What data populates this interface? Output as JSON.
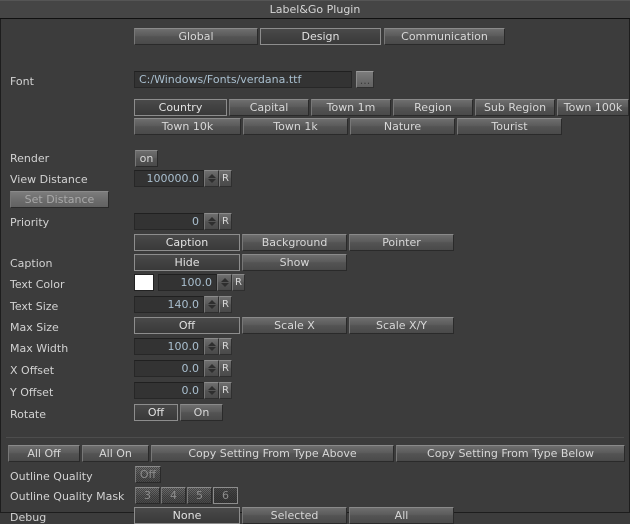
{
  "window": {
    "title": "Label&Go Plugin"
  },
  "main_tabs": [
    {
      "label": "Global",
      "active": false
    },
    {
      "label": "Design",
      "active": true
    },
    {
      "label": "Communication",
      "active": false
    }
  ],
  "font": {
    "label": "Font",
    "path": "C:/Windows/Fonts/verdana.ttf",
    "browse_label": "...",
    "browse_icon": "ellipsis-icon"
  },
  "type_tabs_row1": [
    {
      "label": "Country",
      "active": true
    },
    {
      "label": "Capital",
      "active": false
    },
    {
      "label": "Town 1m",
      "active": false
    },
    {
      "label": "Region",
      "active": false
    },
    {
      "label": "Sub Region",
      "active": false
    },
    {
      "label": "Town 100k",
      "active": false
    }
  ],
  "type_tabs_row2": [
    {
      "label": "Town 10k",
      "active": false
    },
    {
      "label": "Town 1k",
      "active": false
    },
    {
      "label": "Nature",
      "active": false
    },
    {
      "label": "Tourist",
      "active": false
    }
  ],
  "render": {
    "label": "Render",
    "value": "on"
  },
  "view_distance": {
    "label": "View Distance",
    "value": "100000.0",
    "reset_label": "R"
  },
  "set_distance": {
    "label": "Set Distance"
  },
  "priority": {
    "label": "Priority",
    "value": "0",
    "reset_label": "R"
  },
  "element_tabs": [
    {
      "label": "Caption",
      "active": true
    },
    {
      "label": "Background",
      "active": false
    },
    {
      "label": "Pointer",
      "active": false
    }
  ],
  "caption": {
    "label": "Caption",
    "options": [
      {
        "label": "Hide",
        "active": true
      },
      {
        "label": "Show",
        "active": false
      }
    ]
  },
  "text_color": {
    "label": "Text Color",
    "swatch": "#ffffff",
    "value": "100.0",
    "reset_label": "R"
  },
  "text_size": {
    "label": "Text Size",
    "value": "140.0",
    "reset_label": "R"
  },
  "max_size": {
    "label": "Max Size",
    "options": [
      {
        "label": "Off",
        "active": true
      },
      {
        "label": "Scale X",
        "active": false
      },
      {
        "label": "Scale X/Y",
        "active": false
      }
    ]
  },
  "max_width": {
    "label": "Max Width",
    "value": "100.0",
    "reset_label": "R"
  },
  "x_offset": {
    "label": "X Offset",
    "value": "0.0",
    "reset_label": "R"
  },
  "y_offset": {
    "label": "Y Offset",
    "value": "0.0",
    "reset_label": "R"
  },
  "rotate": {
    "label": "Rotate",
    "options": [
      {
        "label": "Off",
        "active": true
      },
      {
        "label": "On",
        "active": false
      }
    ]
  },
  "bulk_actions": [
    {
      "label": "All Off"
    },
    {
      "label": "All On"
    },
    {
      "label": "Copy Setting From Type Above"
    },
    {
      "label": "Copy Setting From Type Below"
    }
  ],
  "outline_quality": {
    "label": "Outline Quality",
    "value": "Off",
    "disabled": true
  },
  "outline_quality_mask": {
    "label": "Outline Quality Mask",
    "options": [
      {
        "label": "3",
        "active": false
      },
      {
        "label": "4",
        "active": false
      },
      {
        "label": "5",
        "active": false
      },
      {
        "label": "6",
        "active": true
      }
    ],
    "disabled": true
  },
  "debug": {
    "label": "Debug",
    "options": [
      {
        "label": "None",
        "active": true
      },
      {
        "label": "Selected",
        "active": false
      },
      {
        "label": "All",
        "active": false
      }
    ]
  }
}
